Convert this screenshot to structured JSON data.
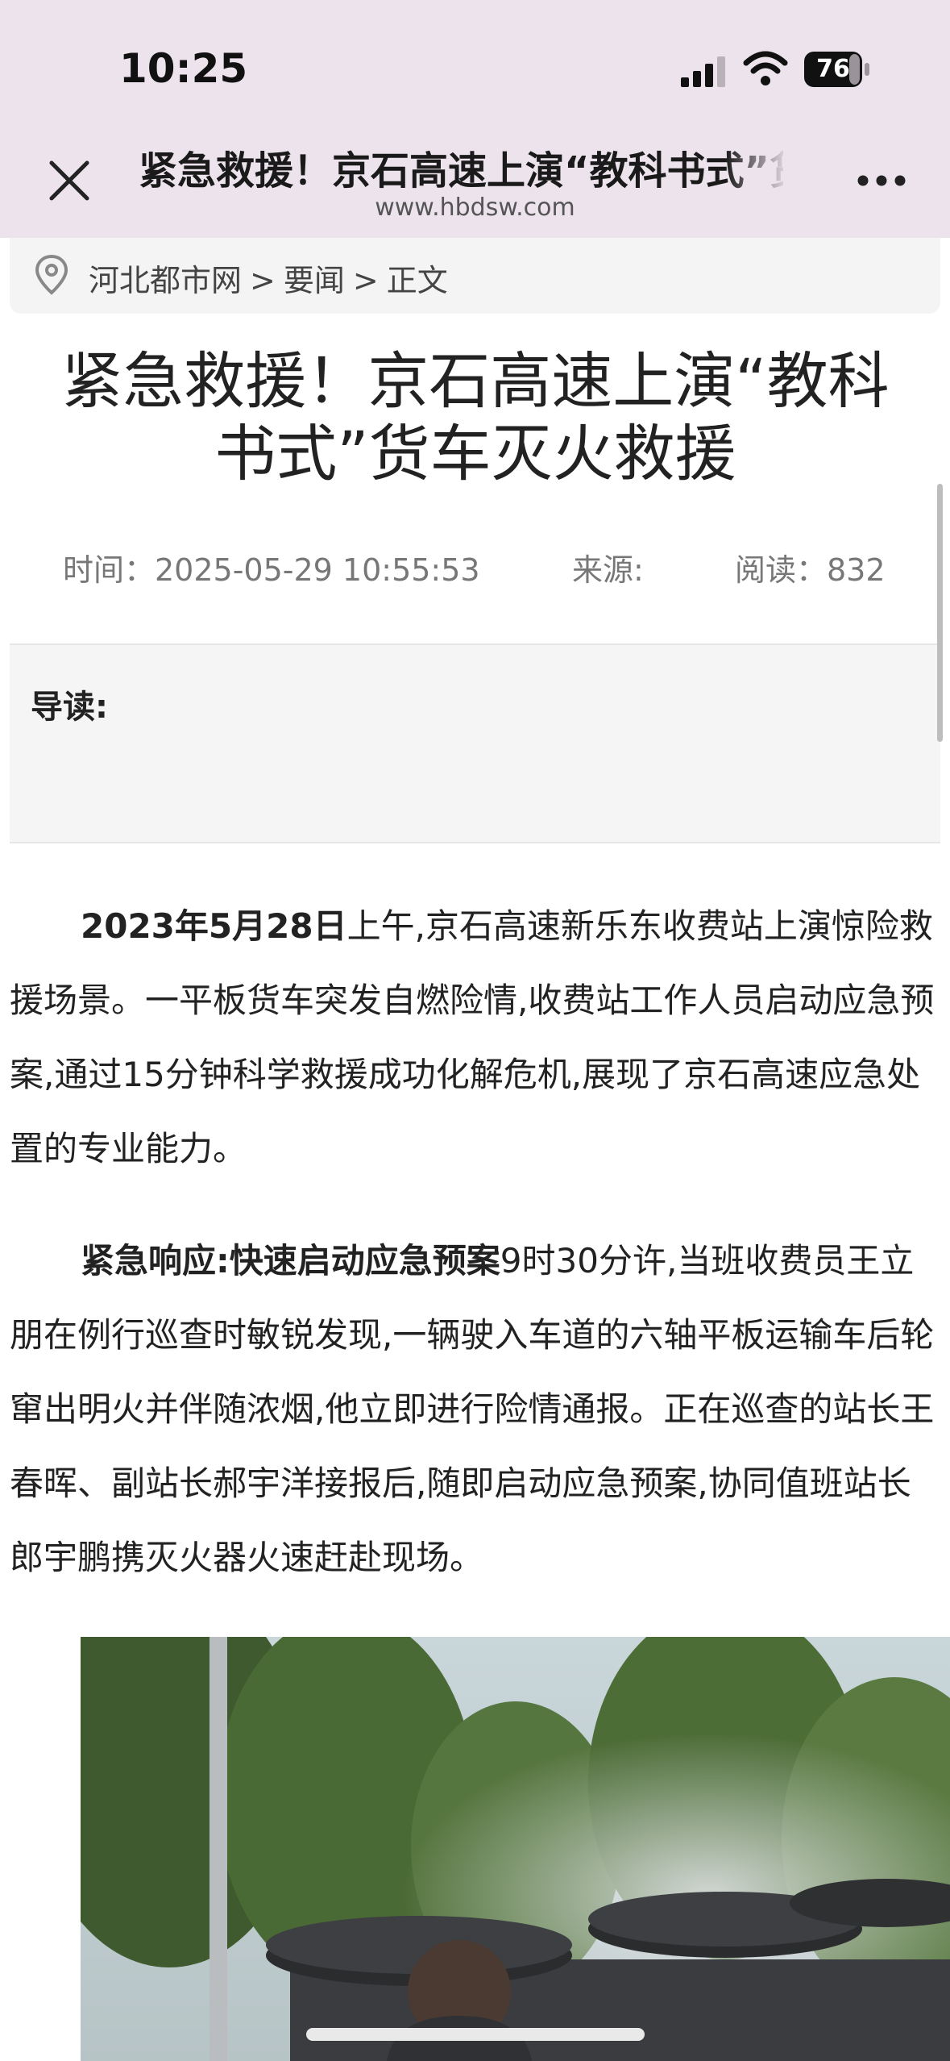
{
  "status_bar": {
    "time": "10:25",
    "battery": "76"
  },
  "header": {
    "title": "紧急救援！京石高速上演“教科书式”货车灭火救援",
    "domain": "www.hbdsw.com"
  },
  "breadcrumb": [
    "河北都市网",
    ">",
    "要闻",
    ">",
    "正文"
  ],
  "article": {
    "headline_line1": "紧急救援！京石高速上演“教科",
    "headline_line2": "书式”货车灭火救援",
    "time": "时间：2025-05-29 10:55:53",
    "source": "来源:",
    "reads": "阅读：832",
    "summary_label": "导读:",
    "p1_bold": "2023年5月28日",
    "p1_text": "上午,京石高速新乐东收费站上演惊险救援场景。一平板货车突发自燃险情,收费站工作人员启动应急预案,通过15分钟科学救援成功化解危机,展现了京石高速应急处置的专业能力。",
    "p2_bold": "紧急响应:快速启动应急预案",
    "p2_text": "9时30分许,当班收费员王立朋在例行巡查时敏锐发现,一辆驶入车道的六轴平板运输车后轮窜出明火并伴随浓烟,他立即进行险情通报。正在巡查的站长王春晖、副站长郝宇洋接报后,随即启动应急预案,协同值班站长郎宇鹏携灭火器火速赶赴现场。"
  },
  "icons": {
    "close": "close-icon",
    "more": "more-icon",
    "location": "location-pin-icon",
    "signal": "cellular-signal-icon",
    "wifi": "wifi-icon",
    "battery": "battery-icon"
  },
  "colors": {
    "header_bg": "#ece3ec",
    "breadcrumb_bg": "#f4f4f4",
    "summary_bg": "#f5f5f5"
  }
}
